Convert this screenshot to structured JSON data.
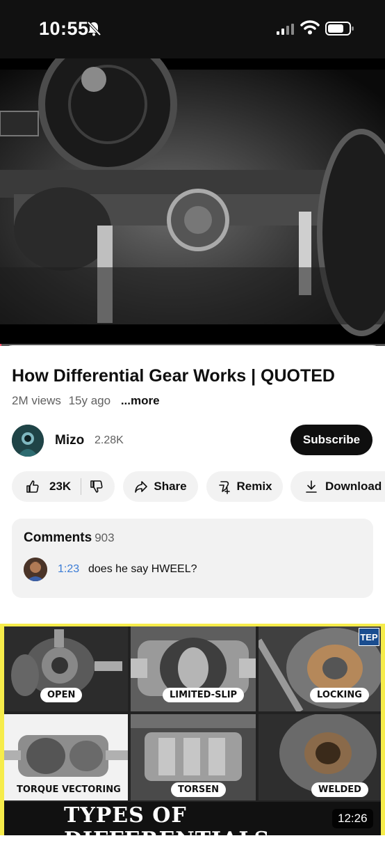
{
  "status_bar": {
    "time": "10:55"
  },
  "video": {
    "progress": 0.0
  },
  "title": "How Differential Gear Works | QUOTED",
  "meta": {
    "views": "2M views",
    "age": "15y ago",
    "more": "...more"
  },
  "channel": {
    "name": "Mizo",
    "subscribers": "2.28K",
    "subscribe_label": "Subscribe"
  },
  "actions": {
    "likes": "23K",
    "share": "Share",
    "remix": "Remix",
    "download": "Download"
  },
  "comments": {
    "label": "Comments",
    "count": "903",
    "top_time": "1:23",
    "top_text": "does he say HWEEL?"
  },
  "next_video": {
    "tiles": [
      "Open",
      "Limited-slip",
      "Locking",
      "Torque Vectoring",
      "Torsen",
      "Welded"
    ],
    "title": "Types of Differentials",
    "duration": "12:26",
    "badge": "TEP"
  },
  "colors": {
    "accent": "#ff4e6a",
    "timestamp": "#3a7bd5",
    "thumb_border": "#f6ec4a"
  }
}
